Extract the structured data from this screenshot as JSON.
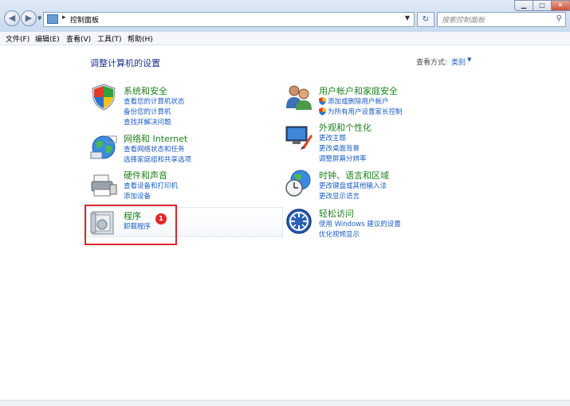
{
  "window": {
    "address_path": "控制面板",
    "search_placeholder": "搜索控制面板"
  },
  "menubar": [
    {
      "label": "文件(F)"
    },
    {
      "label": "编辑(E)"
    },
    {
      "label": "查看(V)"
    },
    {
      "label": "工具(T)"
    },
    {
      "label": "帮助(H)"
    }
  ],
  "main": {
    "title": "调整计算机的设置",
    "view_by_label": "查看方式:",
    "view_by_value": "类别"
  },
  "categories": {
    "system": {
      "title": "系统和安全",
      "icon": "shield-security-icon",
      "links": [
        "查看您的计算机状态",
        "备份您的计算机",
        "查找并解决问题"
      ]
    },
    "network": {
      "title": "网络和 Internet",
      "icon": "globe-network-icon",
      "links": [
        "查看网络状态和任务",
        "选择家庭组和共享选项"
      ]
    },
    "hardware": {
      "title": "硬件和声音",
      "icon": "printer-icon",
      "links": [
        "查看设备和打印机",
        "添加设备"
      ]
    },
    "programs": {
      "title": "程序",
      "icon": "programs-icon",
      "links": [
        "卸载程序"
      ],
      "badge": "1"
    },
    "users": {
      "title": "用户帐户和家庭安全",
      "icon": "users-icon",
      "links": [
        "添加或删除用户帐户",
        "为所有用户设置家长控制"
      ]
    },
    "appearance": {
      "title": "外观和个性化",
      "icon": "monitor-brush-icon",
      "links": [
        "更改主题",
        "更改桌面背景",
        "调整屏幕分辨率"
      ]
    },
    "clock": {
      "title": "时钟、语言和区域",
      "icon": "globe-clock-icon",
      "links": [
        "更改键盘或其他输入法",
        "更改显示语言"
      ]
    },
    "ease": {
      "title": "轻松访问",
      "icon": "ease-of-access-icon",
      "links": [
        "使用 Windows 建议的设置",
        "优化视频显示"
      ]
    }
  },
  "colors": {
    "category_title": "#1e7f1e",
    "link": "#1a5cc4",
    "highlight": "#d9262a"
  }
}
